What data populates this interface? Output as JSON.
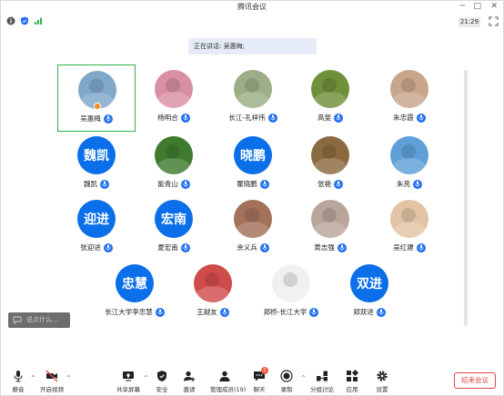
{
  "window": {
    "title": "腾讯会议",
    "min_label": "─",
    "max_label": "□",
    "close_label": "✕"
  },
  "status": {
    "time": "21:29"
  },
  "speaking": {
    "text": "正在讲话: 吴惠梅;"
  },
  "participants": [
    {
      "name": "吴惠梅",
      "avatar_text": "",
      "color": "#7fa8c9",
      "active": true
    },
    {
      "name": "杨明合",
      "avatar_text": "",
      "color": "#d98fa2"
    },
    {
      "name": "长江-孔祥伟",
      "avatar_text": "",
      "color": "#9cae86"
    },
    {
      "name": "高斐",
      "avatar_text": "",
      "color": "#6f8f3a"
    },
    {
      "name": "朱忠霞",
      "avatar_text": "",
      "color": "#c9a58b"
    },
    {
      "name": "魏凯",
      "avatar_text": "魏凯"
    },
    {
      "name": "能青山",
      "avatar_text": "",
      "color": "#3f7a2e"
    },
    {
      "name": "瞿晓鹏",
      "avatar_text": "晓鹏"
    },
    {
      "name": "张艳",
      "avatar_text": "",
      "color": "#8b6a3f"
    },
    {
      "name": "朱亮",
      "avatar_text": "",
      "color": "#5fa0d8"
    },
    {
      "name": "张迎进",
      "avatar_text": "迎进"
    },
    {
      "name": "夏宏南",
      "avatar_text": "宏南"
    },
    {
      "name": "余义兵",
      "avatar_text": "",
      "color": "#a3715a"
    },
    {
      "name": "黄志强",
      "avatar_text": "",
      "color": "#b9a59a"
    },
    {
      "name": "吴红建",
      "avatar_text": "",
      "color": "#e2c4a4"
    },
    {
      "name": "长江大学李忠慧",
      "avatar_text": "忠慧"
    },
    {
      "name": "王越友",
      "avatar_text": "",
      "color": "#d04b4b"
    },
    {
      "name": "郑桥-长江大学",
      "avatar_text": "",
      "color": "#f0f0f0"
    },
    {
      "name": "郑双进",
      "avatar_text": "双进"
    }
  ],
  "chat": {
    "placeholder": "说点什么..."
  },
  "toolbar": {
    "mute": "静音",
    "video": "开启视频",
    "share": "共享屏幕",
    "security": "安全",
    "invite": "邀请",
    "members": "管理成员(19)",
    "chat": "聊天",
    "chat_badge": "1",
    "record": "录制",
    "breakout": "分组讨论",
    "apps": "应用",
    "settings": "设置",
    "end": "结束会议"
  },
  "colors": {
    "accent": "#1f6ff2",
    "avatar_blue": "#0a6fe8",
    "end_red": "#e54545",
    "active_border": "#2db34a"
  }
}
